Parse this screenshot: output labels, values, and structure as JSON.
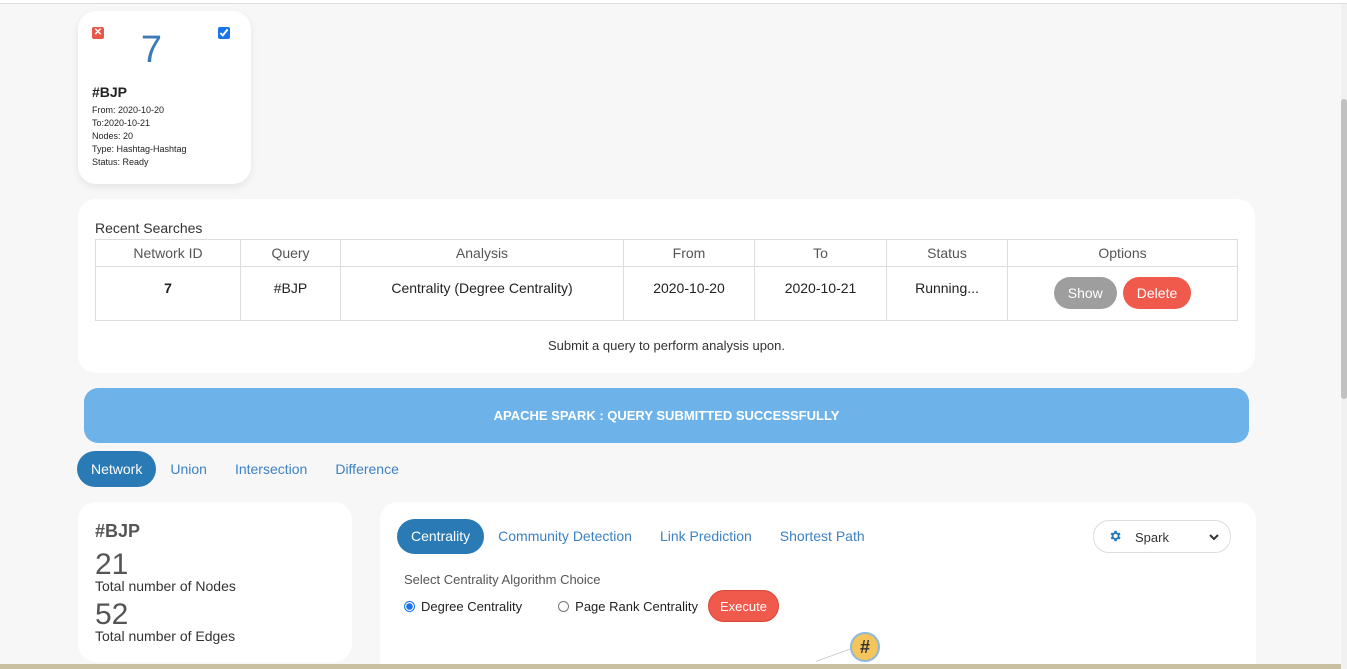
{
  "network_card": {
    "number": "7",
    "title": "#BJP",
    "from": "From: 2020-10-20",
    "to": "To:2020-10-21",
    "nodes": "Nodes: 20",
    "type": "Type: Hashtag-Hashtag",
    "status": "Status: Ready",
    "checked": true
  },
  "recent_searches": {
    "title": "Recent Searches",
    "columns": [
      "Network ID",
      "Query",
      "Analysis",
      "From",
      "To",
      "Status",
      "Options"
    ],
    "rows": [
      {
        "network_id": "7",
        "query": "#BJP",
        "analysis": "Centrality (Degree Centrality)",
        "from": "2020-10-20",
        "to": "2020-10-21",
        "status": "Running..."
      }
    ],
    "show_label": "Show",
    "delete_label": "Delete",
    "hint": "Submit a query to perform analysis upon."
  },
  "alert": {
    "text": "APACHE SPARK : QUERY SUBMITTED SUCCESSFULLY",
    "color": "#6db3ea"
  },
  "main_tabs": [
    {
      "label": "Network",
      "active": true
    },
    {
      "label": "Union",
      "active": false
    },
    {
      "label": "Intersection",
      "active": false
    },
    {
      "label": "Difference",
      "active": false
    }
  ],
  "stats": {
    "title": "#BJP",
    "nodes_count": "21",
    "nodes_label": "Total number of Nodes",
    "edges_count": "52",
    "edges_label": "Total number of Edges"
  },
  "analysis": {
    "tabs": [
      {
        "label": "Centrality",
        "active": true
      },
      {
        "label": "Community Detection",
        "active": false
      },
      {
        "label": "Link Prediction",
        "active": false
      },
      {
        "label": "Shortest Path",
        "active": false
      }
    ],
    "engine": {
      "label": "Spark",
      "icon": "gear-icon"
    },
    "algo_prompt": "Select Centrality Algorithm Choice",
    "options": [
      {
        "label": "Degree Centrality",
        "selected": true
      },
      {
        "label": "Page Rank Centrality",
        "selected": false
      }
    ],
    "execute_label": "Execute",
    "graph_node_label": "#"
  },
  "colors": {
    "primary": "#2a7ab6",
    "link": "#3c82c4",
    "danger": "#f05a4d",
    "muted_button": "#9e9e9e"
  }
}
